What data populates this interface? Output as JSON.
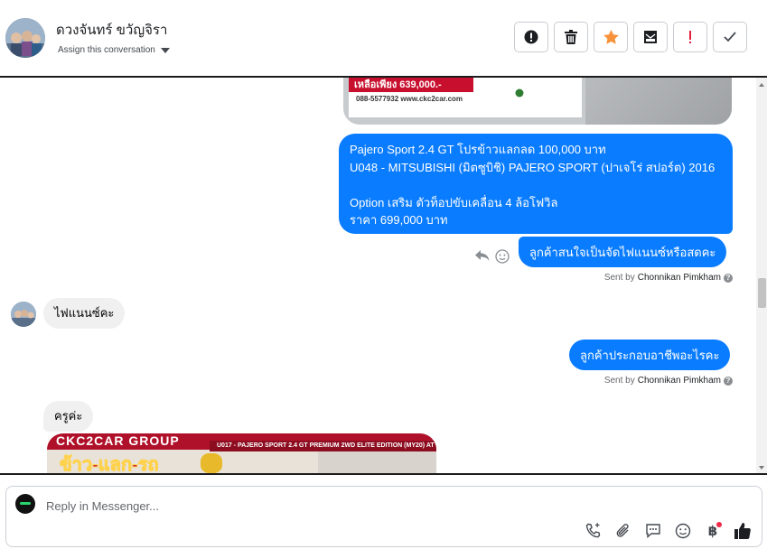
{
  "header": {
    "contact_name": "ดวงจันทร์ ขวัญจิรา",
    "assign_label": "Assign this conversation",
    "actions": [
      {
        "name": "spam-button",
        "icon": "alert-circle-icon"
      },
      {
        "name": "delete-button",
        "icon": "trash-icon"
      },
      {
        "name": "star-button",
        "icon": "star-icon",
        "color": "#f7923a"
      },
      {
        "name": "mark-unread-button",
        "icon": "envelope-icon"
      },
      {
        "name": "important-button",
        "icon": "exclamation-icon",
        "color": "#e41e3f"
      },
      {
        "name": "done-button",
        "icon": "check-icon"
      }
    ]
  },
  "top_image": {
    "price_text": "เหลือเพียง 639,000.-",
    "contact_text": "088-5577932 www.ckc2car.com"
  },
  "messages": [
    {
      "direction": "out",
      "text": "Pajero Sport 2.4 GT โปรข้าวแลกลด 100,000 บาท\nU048 - MITSUBISHI (มิตซูบิชิ) PAJERO SPORT (ปาเจโร่ สปอร์ต) 2016\n\n Option เสริม ตัวท็อปขับเคลื่อน 4 ล้อโฟวิล\nราคา 699,000 บาท"
    },
    {
      "direction": "out",
      "text": "ลูกค้าสนใจเป็นจัดไฟแนนซ์หรือสดคะ"
    },
    {
      "direction": "in",
      "text": "ไฟแนนซ์คะ"
    },
    {
      "direction": "out",
      "text": "ลูกค้าประกอบอาชีพอะไรคะ"
    },
    {
      "direction": "in",
      "text": "ครูค่ะ"
    }
  ],
  "sent_by": {
    "prefix": "Sent by",
    "agent": "Chonnikan Pimkham",
    "help": "?"
  },
  "bottom_image": {
    "logo_text": "CKC2CAR GROUP",
    "slogan_text": "ข้าว-แลก-รถ",
    "banner_text": "U017 - PAJERO SPORT 2.4 GT PREMIUM 2WD ELITE EDITION (MY20) AT"
  },
  "composer": {
    "placeholder": "Reply in Messenger...",
    "tools": [
      "phone-icon",
      "attachment-icon",
      "saved-reply-icon",
      "emoji-icon",
      "baht-icon",
      "like-icon"
    ]
  }
}
